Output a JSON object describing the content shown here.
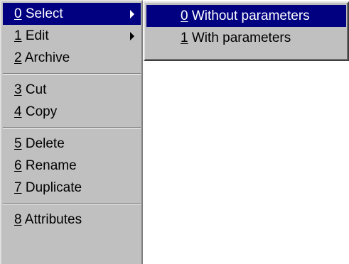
{
  "menu": {
    "groups": [
      [
        {
          "mnemonic": "0",
          "label": " Select",
          "has_submenu": true,
          "active": true
        },
        {
          "mnemonic": "1",
          "label": " Edit",
          "has_submenu": true,
          "active": false
        },
        {
          "mnemonic": "2",
          "label": " Archive",
          "has_submenu": false,
          "active": false
        }
      ],
      [
        {
          "mnemonic": "3",
          "label": " Cut",
          "has_submenu": false,
          "active": false
        },
        {
          "mnemonic": "4",
          "label": " Copy",
          "has_submenu": false,
          "active": false
        }
      ],
      [
        {
          "mnemonic": "5",
          "label": " Delete",
          "has_submenu": false,
          "active": false
        },
        {
          "mnemonic": "6",
          "label": " Rename",
          "has_submenu": false,
          "active": false
        },
        {
          "mnemonic": "7",
          "label": " Duplicate",
          "has_submenu": false,
          "active": false
        }
      ],
      [
        {
          "mnemonic": "8",
          "label": " Attributes",
          "has_submenu": false,
          "active": false
        }
      ]
    ]
  },
  "submenu": {
    "items": [
      {
        "mnemonic": "0",
        "label": " Without parameters",
        "active": true
      },
      {
        "mnemonic": "1",
        "label": " With parameters",
        "active": false
      }
    ]
  },
  "colors": {
    "menu_face": "#c0c0c0",
    "highlight": "#000080",
    "highlight_text": "#ffffff",
    "text": "#000000",
    "background": "#ffffff"
  },
  "icons": {
    "submenu_arrow": "triangle-right-icon"
  }
}
